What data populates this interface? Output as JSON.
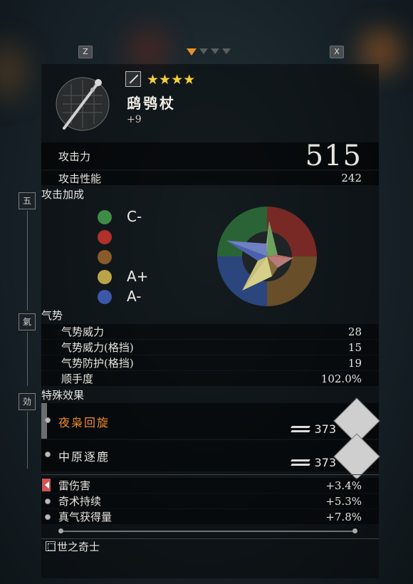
{
  "nav": {
    "prev_key": "Z",
    "next_key": "X",
    "pages": 4,
    "active_page": 1
  },
  "weapon": {
    "name": "鸱鸮杖",
    "level": "+9",
    "stars": 4,
    "stars_text": "★★★★"
  },
  "stats_main": {
    "attack_label": "攻击力",
    "attack_value": "515",
    "performance_label": "攻击性能",
    "performance_value": "242"
  },
  "scaling": {
    "badge": "五",
    "title": "攻击加成",
    "elements": [
      {
        "icon": "wood-icon",
        "color": "#3f8c45",
        "grade": "C-"
      },
      {
        "icon": "fire-icon",
        "color": "#b0302a",
        "grade": ""
      },
      {
        "icon": "earth-icon",
        "color": "#8a5a2a",
        "grade": ""
      },
      {
        "icon": "metal-icon",
        "color": "#b9a448",
        "grade": "A+"
      },
      {
        "icon": "water-icon",
        "color": "#3b58a8",
        "grade": "A-"
      }
    ]
  },
  "ki": {
    "badge": "氣",
    "title": "气势",
    "rows": [
      {
        "label": "气势威力",
        "value": "28"
      },
      {
        "label": "气势威力(格挡)",
        "value": "15"
      },
      {
        "label": "气势防护(格挡)",
        "value": "19"
      },
      {
        "label": "顺手度",
        "value": "102.0%"
      }
    ]
  },
  "effects": {
    "badge": "効",
    "title": "特殊效果",
    "skills": [
      {
        "name": "夜枭回旋",
        "cost": "373",
        "color": "#f08a30"
      },
      {
        "name": "中原逐鹿",
        "cost": "373",
        "color": "#e6e4df"
      }
    ],
    "bonuses": [
      {
        "label": "雷伤害",
        "value": "+3.4%"
      },
      {
        "label": "奇术持续",
        "value": "+5.3%"
      },
      {
        "label": "真气获得量",
        "value": "+7.8%"
      }
    ]
  },
  "set_name": "世之奇士",
  "colors": {
    "accent": "#e7902a",
    "star": "#f6cf3a",
    "skill_highlight": "#f08a30"
  }
}
